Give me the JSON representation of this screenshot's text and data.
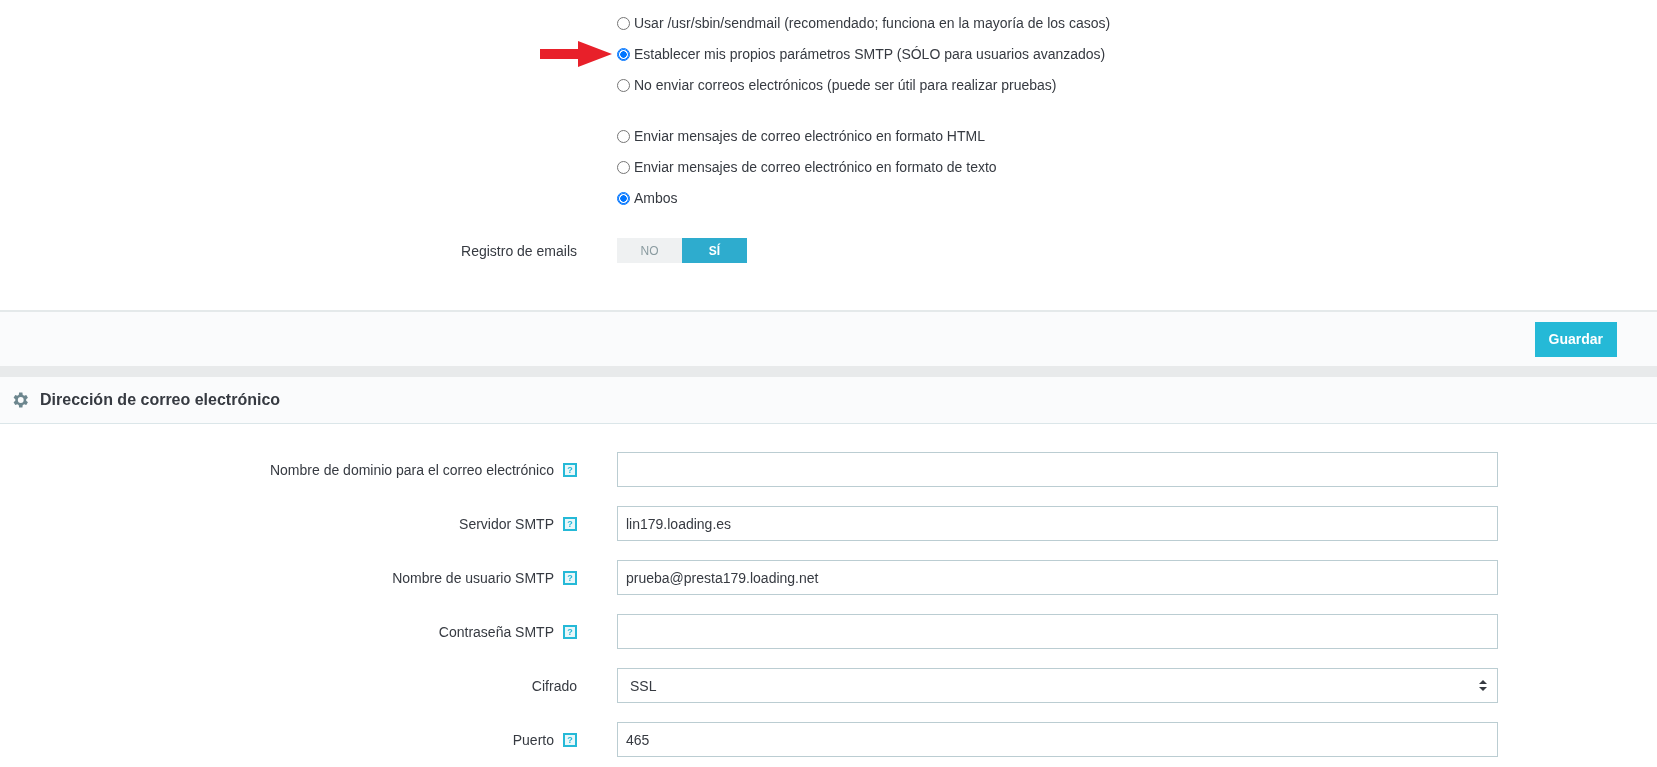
{
  "mail_method": [
    {
      "label": "Usar /usr/sbin/sendmail (recomendado; funciona en la mayoría de los casos)",
      "selected": false
    },
    {
      "label": "Establecer mis propios parámetros SMTP (SÓLO para usuarios avanzados)",
      "selected": true
    },
    {
      "label": "No enviar correos electrónicos (puede ser útil para realizar pruebas)",
      "selected": false
    }
  ],
  "mail_format": [
    {
      "label": "Enviar mensajes de correo electrónico en formato HTML",
      "selected": false
    },
    {
      "label": "Enviar mensajes de correo electrónico en formato de texto",
      "selected": false
    },
    {
      "label": "Ambos",
      "selected": true
    }
  ],
  "email_log": {
    "label": "Registro de emails",
    "options": [
      {
        "label": "NO",
        "selected": false
      },
      {
        "label": "SÍ",
        "selected": true
      }
    ]
  },
  "save_button": "Guardar",
  "panel": {
    "title": "Dirección de correo electrónico",
    "fields": [
      {
        "kind": "text",
        "label": "Nombre de dominio para el correo electrónico",
        "help": "?"
      },
      {
        "kind": "text",
        "label": "Servidor SMTP",
        "help": "?",
        "value": "lin179.loading.es"
      },
      {
        "kind": "text",
        "label": "Nombre de usuario SMTP",
        "help": "?",
        "value": "prueba@presta179.loading.net"
      },
      {
        "kind": "text",
        "label": "Contraseña SMTP",
        "help": "?"
      },
      {
        "kind": "select",
        "label": "Cifrado",
        "value": "SSL"
      },
      {
        "kind": "text",
        "label": "Puerto",
        "help": "?",
        "value": "465"
      }
    ]
  }
}
